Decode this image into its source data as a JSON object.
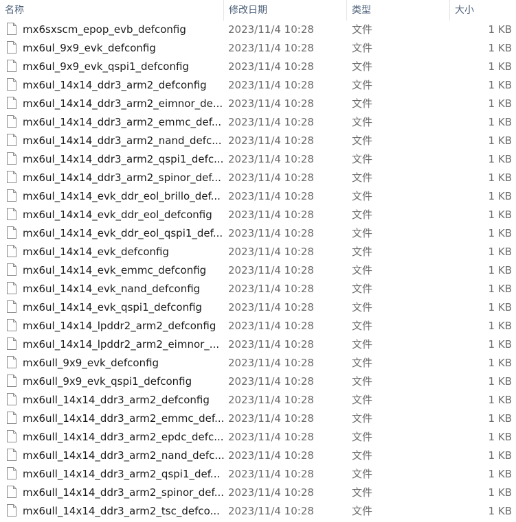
{
  "columns": {
    "name": "名称",
    "date_modified": "修改日期",
    "type": "类型",
    "size": "大小"
  },
  "sort_indicator": "^",
  "file_icon": "document-icon",
  "files": [
    {
      "name": "mx6sxscm_epop_evb_defconfig",
      "date": "2023/11/4 10:28",
      "type": "文件",
      "size": "1 KB"
    },
    {
      "name": "mx6ul_9x9_evk_defconfig",
      "date": "2023/11/4 10:28",
      "type": "文件",
      "size": "1 KB"
    },
    {
      "name": "mx6ul_9x9_evk_qspi1_defconfig",
      "date": "2023/11/4 10:28",
      "type": "文件",
      "size": "1 KB"
    },
    {
      "name": "mx6ul_14x14_ddr3_arm2_defconfig",
      "date": "2023/11/4 10:28",
      "type": "文件",
      "size": "1 KB"
    },
    {
      "name": "mx6ul_14x14_ddr3_arm2_eimnor_de...",
      "date": "2023/11/4 10:28",
      "type": "文件",
      "size": "1 KB"
    },
    {
      "name": "mx6ul_14x14_ddr3_arm2_emmc_def...",
      "date": "2023/11/4 10:28",
      "type": "文件",
      "size": "1 KB"
    },
    {
      "name": "mx6ul_14x14_ddr3_arm2_nand_defc...",
      "date": "2023/11/4 10:28",
      "type": "文件",
      "size": "1 KB"
    },
    {
      "name": "mx6ul_14x14_ddr3_arm2_qspi1_defc...",
      "date": "2023/11/4 10:28",
      "type": "文件",
      "size": "1 KB"
    },
    {
      "name": "mx6ul_14x14_ddr3_arm2_spinor_def...",
      "date": "2023/11/4 10:28",
      "type": "文件",
      "size": "1 KB"
    },
    {
      "name": "mx6ul_14x14_evk_ddr_eol_brillo_def...",
      "date": "2023/11/4 10:28",
      "type": "文件",
      "size": "1 KB"
    },
    {
      "name": "mx6ul_14x14_evk_ddr_eol_defconfig",
      "date": "2023/11/4 10:28",
      "type": "文件",
      "size": "1 KB"
    },
    {
      "name": "mx6ul_14x14_evk_ddr_eol_qspi1_def...",
      "date": "2023/11/4 10:28",
      "type": "文件",
      "size": "1 KB"
    },
    {
      "name": "mx6ul_14x14_evk_defconfig",
      "date": "2023/11/4 10:28",
      "type": "文件",
      "size": "1 KB"
    },
    {
      "name": "mx6ul_14x14_evk_emmc_defconfig",
      "date": "2023/11/4 10:28",
      "type": "文件",
      "size": "1 KB"
    },
    {
      "name": "mx6ul_14x14_evk_nand_defconfig",
      "date": "2023/11/4 10:28",
      "type": "文件",
      "size": "1 KB"
    },
    {
      "name": "mx6ul_14x14_evk_qspi1_defconfig",
      "date": "2023/11/4 10:28",
      "type": "文件",
      "size": "1 KB"
    },
    {
      "name": "mx6ul_14x14_lpddr2_arm2_defconfig",
      "date": "2023/11/4 10:28",
      "type": "文件",
      "size": "1 KB"
    },
    {
      "name": "mx6ul_14x14_lpddr2_arm2_eimnor_...",
      "date": "2023/11/4 10:28",
      "type": "文件",
      "size": "1 KB"
    },
    {
      "name": "mx6ull_9x9_evk_defconfig",
      "date": "2023/11/4 10:28",
      "type": "文件",
      "size": "1 KB"
    },
    {
      "name": "mx6ull_9x9_evk_qspi1_defconfig",
      "date": "2023/11/4 10:28",
      "type": "文件",
      "size": "1 KB"
    },
    {
      "name": "mx6ull_14x14_ddr3_arm2_defconfig",
      "date": "2023/11/4 10:28",
      "type": "文件",
      "size": "1 KB"
    },
    {
      "name": "mx6ull_14x14_ddr3_arm2_emmc_def...",
      "date": "2023/11/4 10:28",
      "type": "文件",
      "size": "1 KB"
    },
    {
      "name": "mx6ull_14x14_ddr3_arm2_epdc_defc...",
      "date": "2023/11/4 10:28",
      "type": "文件",
      "size": "1 KB"
    },
    {
      "name": "mx6ull_14x14_ddr3_arm2_nand_defc...",
      "date": "2023/11/4 10:28",
      "type": "文件",
      "size": "1 KB"
    },
    {
      "name": "mx6ull_14x14_ddr3_arm2_qspi1_def...",
      "date": "2023/11/4 10:28",
      "type": "文件",
      "size": "1 KB"
    },
    {
      "name": "mx6ull_14x14_ddr3_arm2_spinor_def...",
      "date": "2023/11/4 10:28",
      "type": "文件",
      "size": "1 KB"
    },
    {
      "name": "mx6ull_14x14_ddr3_arm2_tsc_defco...",
      "date": "2023/11/4 10:28",
      "type": "文件",
      "size": "1 KB"
    }
  ]
}
